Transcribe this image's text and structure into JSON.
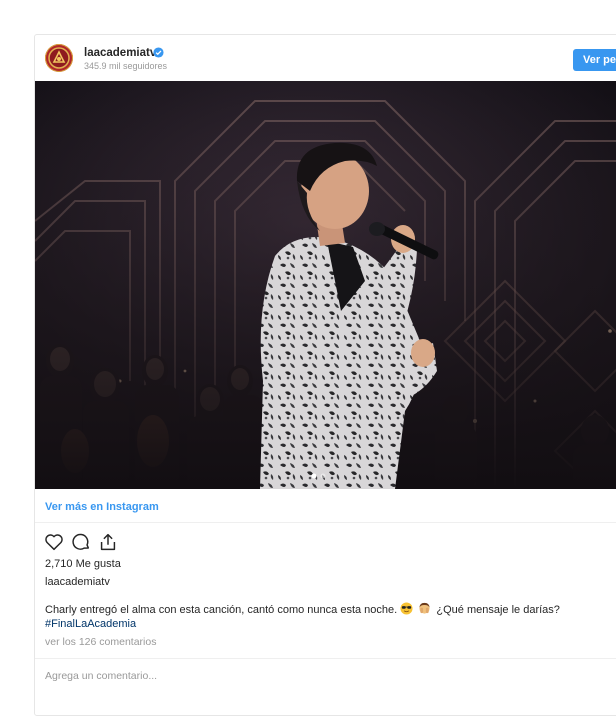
{
  "header": {
    "username": "laacademiatv",
    "followers": "345.9 mil seguidores",
    "follow_button": "Ver pe"
  },
  "media": {
    "description_icon": "photo",
    "carousel_dots": 2,
    "active_dot": 0
  },
  "links": {
    "view_more": "Ver más en Instagram"
  },
  "actions": {
    "like_icon": "heart-icon",
    "comment_icon": "comment-icon",
    "share_icon": "share-icon"
  },
  "post": {
    "likes": "2,710 Me gusta",
    "owner": "laacademiatv",
    "caption_before": "Charly entregó el alma con esta canción, cantó como nunca esta noche.",
    "caption_after": "¿Qué mensaje le darías?",
    "hashtag": "#FinalLaAcademia",
    "view_comments": "ver los 126 comentarios",
    "add_comment_placeholder": "Agrega un comentario..."
  },
  "colors": {
    "link_blue": "#3897f0",
    "hashtag_blue": "#003569",
    "muted": "#999999"
  }
}
